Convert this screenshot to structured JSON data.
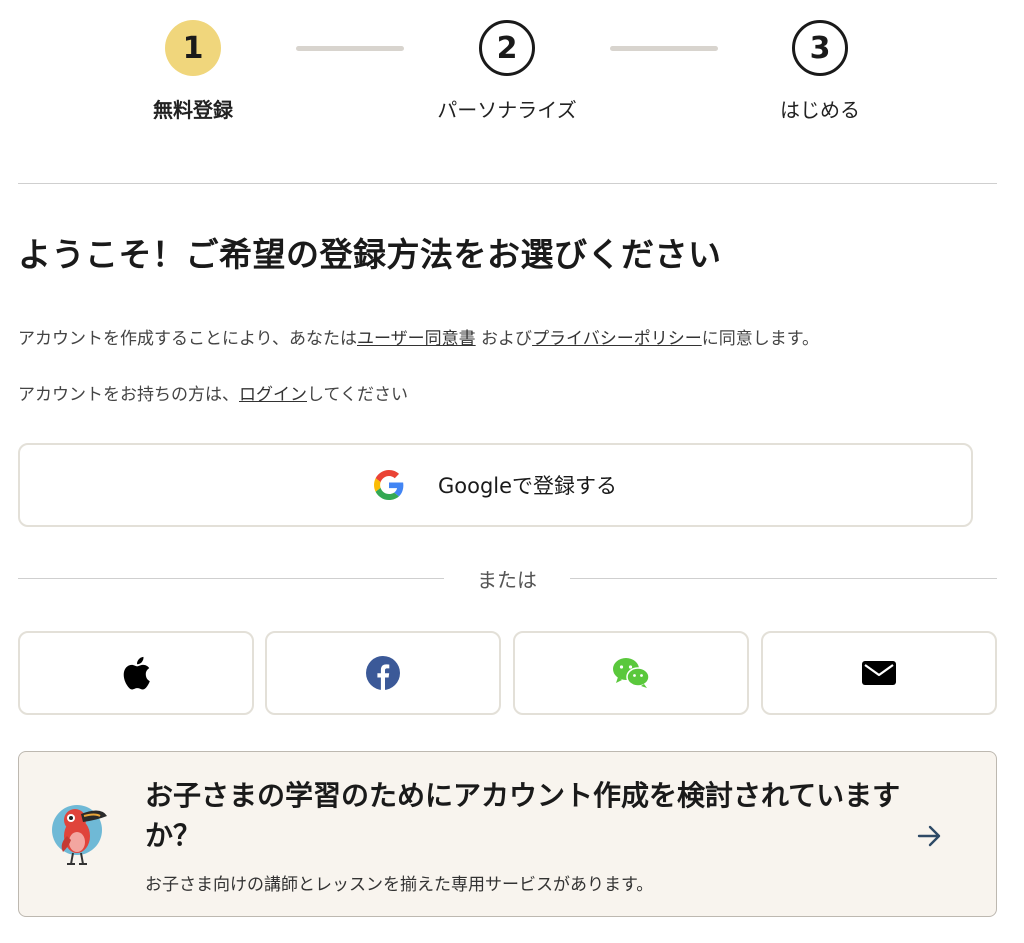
{
  "stepper": {
    "steps": [
      {
        "number": "1",
        "label": "無料登録"
      },
      {
        "number": "2",
        "label": "パーソナライズ"
      },
      {
        "number": "3",
        "label": "はじめる"
      }
    ]
  },
  "heading": "ようこそ！ご希望の登録方法をお選びください",
  "terms": {
    "prefix": "アカウントを作成することにより、あなたは",
    "user_agreement_link": "ユーザー同意書",
    "middle": " および",
    "privacy_link": "プライバシーポリシー",
    "suffix": "に同意します。"
  },
  "login_line": {
    "prefix": "アカウントをお持ちの方は、",
    "login_link": "ログイン",
    "suffix": "してください"
  },
  "google_button": {
    "label": "Googleで登録する",
    "icon": "google-icon"
  },
  "separator_text": "または",
  "social_buttons": [
    {
      "icon": "apple-icon",
      "color": "#000000"
    },
    {
      "icon": "facebook-icon",
      "color": "#3b5998"
    },
    {
      "icon": "wechat-icon",
      "color": "#5ac83c"
    },
    {
      "icon": "mail-icon",
      "color": "#000000"
    }
  ],
  "kids_card": {
    "title": "お子さまの学習のためにアカウント作成を検討されていますか？",
    "subtitle": "お子さま向けの講師とレッスンを揃えた専用サービスがあります。",
    "icon": "bird-mascot-icon",
    "arrow_icon": "arrow-right-icon"
  },
  "colors": {
    "active_step": "#f0d67c",
    "step_line": "#d8d4ce",
    "button_border": "#e3e0d8",
    "card_background": "#f8f4ee"
  }
}
